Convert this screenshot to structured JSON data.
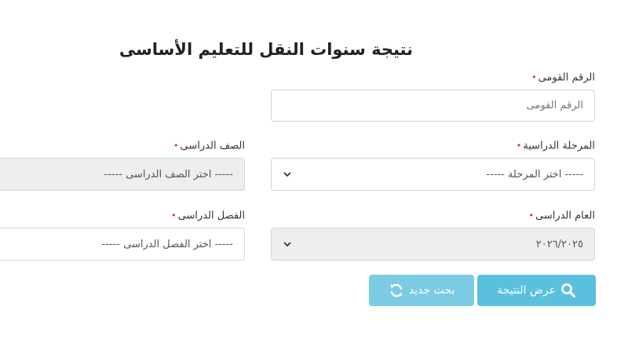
{
  "form": {
    "title": "نتيجة سنوات النقل للتعليم الأساسى",
    "required_marker": "•",
    "national_id": {
      "label": "الرقم القومى",
      "placeholder": "الرقم القومى",
      "value": ""
    },
    "stage": {
      "label": "المرحلة الدراسية",
      "selected": "----- اختر المرحلة -----"
    },
    "grade": {
      "label": "الصف الدراسى",
      "selected": "----- اختر الصف الدراسى -----"
    },
    "year": {
      "label": "العام الدراسى",
      "selected": "٢٠٢٦/٢٠٢٥"
    },
    "term": {
      "label": "الفصل الدراسى",
      "selected": "----- اختر الفصل الدراسى -----"
    }
  },
  "buttons": {
    "show_result": "عرض النتيجة",
    "new_search": "بحث جديد"
  },
  "colors": {
    "button_primary": "#5bc0de",
    "button_secondary": "#7ccbe4",
    "required": "#d0312d",
    "disabled_field": "#eceeef"
  }
}
